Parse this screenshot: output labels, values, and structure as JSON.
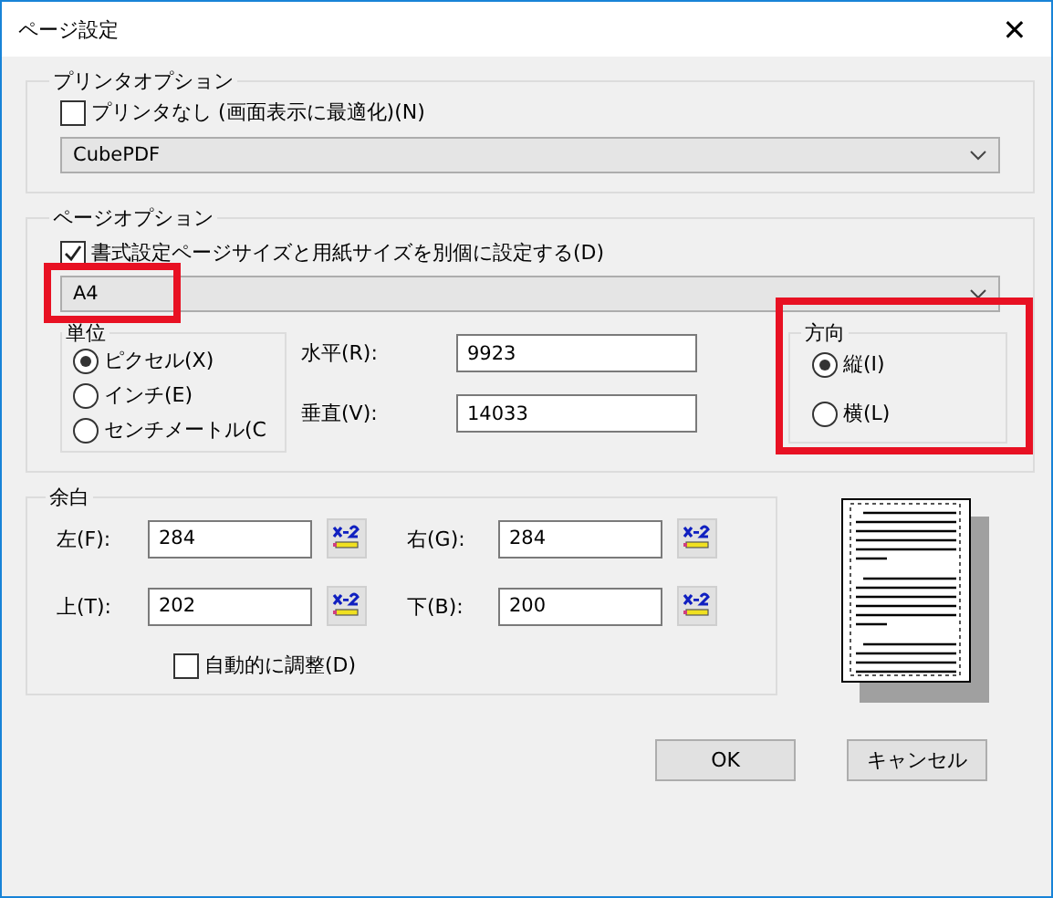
{
  "window": {
    "title": "ページ設定",
    "close": "✕"
  },
  "printer_options": {
    "legend": "プリンタオプション",
    "no_printer": {
      "label": "プリンタなし (画面表示に最適化)(N)",
      "checked": false
    },
    "printer": {
      "value": "CubePDF"
    }
  },
  "page_options": {
    "legend": "ページオプション",
    "separate_size": {
      "label": "書式設定ページサイズと用紙サイズを別個に設定する(D)",
      "checked": true
    },
    "paper_size": {
      "value": "A4",
      "highlighted": true
    },
    "unit": {
      "legend": "単位",
      "options": [
        {
          "label": "ピクセル(X)",
          "selected": true
        },
        {
          "label": "インチ(E)",
          "selected": false
        },
        {
          "label": "センチメートル(C",
          "selected": false
        }
      ]
    },
    "horizontal": {
      "label": "水平(R):",
      "value": "9923"
    },
    "vertical": {
      "label": "垂直(V):",
      "value": "14033"
    },
    "orientation": {
      "legend": "方向",
      "highlighted": true,
      "options": [
        {
          "label": "縦(I)",
          "selected": true
        },
        {
          "label": "横(L)",
          "selected": false
        }
      ]
    }
  },
  "margins": {
    "legend": "余白",
    "fields": [
      {
        "label": "左(F):",
        "value": "284"
      },
      {
        "label": "右(G):",
        "value": "284"
      },
      {
        "label": "上(T):",
        "value": "202"
      },
      {
        "label": "下(B):",
        "value": "200"
      }
    ],
    "auto_adjust": {
      "label": "自動的に調整(D)",
      "checked": false
    }
  },
  "buttons": [
    {
      "label": "OK"
    },
    {
      "label": "キャンセル"
    }
  ]
}
